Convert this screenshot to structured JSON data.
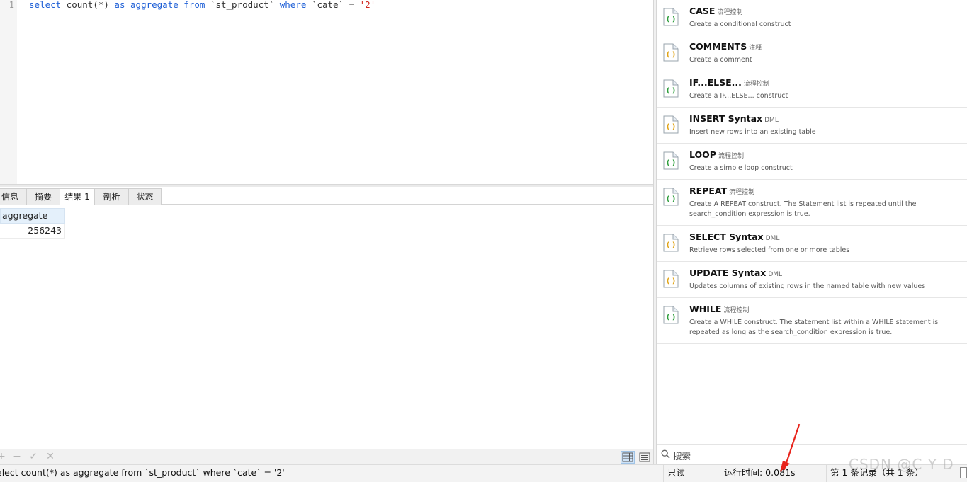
{
  "editor": {
    "line_number": "1",
    "tokens": {
      "t1": "select",
      "t2": " count(*) ",
      "t3": "as",
      "t4": " ",
      "t5": "aggregate",
      "t6": " ",
      "t7": "from",
      "t8": " `st_product` ",
      "t9": "where",
      "t10": " `cate` = ",
      "t11": "'2'"
    }
  },
  "tabs": [
    {
      "label": "信息"
    },
    {
      "label": "摘要"
    },
    {
      "label": "结果 1"
    },
    {
      "label": "剖析"
    },
    {
      "label": "状态"
    }
  ],
  "result": {
    "columns": [
      "aggregate"
    ],
    "rows": [
      [
        "256243"
      ]
    ]
  },
  "toolbar": {
    "add_icon": "+",
    "delete_icon": "−",
    "apply_icon": "✓",
    "discard_icon": "✕"
  },
  "status": {
    "sql": "elect count(*) as aggregate from `st_product` where `cate` = '2'",
    "readonly": "只读",
    "runtime": "运行时间: 0.081s",
    "records": "第 1 条记录（共 1 条）"
  },
  "snippets": [
    {
      "title": "CASE",
      "tag": "流程控制",
      "desc": "Create a conditional construct",
      "icon": "code-snippet-icon",
      "icon_color": "#2e9e3c"
    },
    {
      "title": "COMMENTS",
      "tag": "注释",
      "desc": "Create a comment",
      "icon": "code-snippet-icon",
      "icon_color": "#e0a417"
    },
    {
      "title": "IF...ELSE...",
      "tag": "流程控制",
      "desc": "Create a IF...ELSE... construct",
      "icon": "code-snippet-icon",
      "icon_color": "#2e9e3c"
    },
    {
      "title": "INSERT Syntax",
      "tag": "DML",
      "desc": "Insert new rows into an existing table",
      "icon": "code-snippet-icon",
      "icon_color": "#e0a417"
    },
    {
      "title": "LOOP",
      "tag": "流程控制",
      "desc": "Create a simple loop construct",
      "icon": "code-snippet-icon",
      "icon_color": "#2e9e3c"
    },
    {
      "title": "REPEAT",
      "tag": "流程控制",
      "desc": "Create A REPEAT construct. The Statement list is repeated until the search_condition expression is true.",
      "icon": "code-snippet-icon",
      "icon_color": "#2e9e3c"
    },
    {
      "title": "SELECT Syntax",
      "tag": "DML",
      "desc": "Retrieve rows selected from one or more tables",
      "icon": "code-snippet-icon",
      "icon_color": "#e0a417"
    },
    {
      "title": "UPDATE Syntax",
      "tag": "DML",
      "desc": "Updates columns of existing rows in the named table with new values",
      "icon": "code-snippet-icon",
      "icon_color": "#e0a417"
    },
    {
      "title": "WHILE",
      "tag": "流程控制",
      "desc": "Create a WHILE construct. The statement list within a WHILE statement is repeated as long as the search_condition expression is true.",
      "icon": "code-snippet-icon",
      "icon_color": "#2e9e3c"
    }
  ],
  "snippet_search": {
    "label": "搜索",
    "icon": "search-icon"
  },
  "watermark": "CSDN @C Y D",
  "colors": {
    "keyword": "#1e5fd6",
    "string": "#d0241a",
    "annotation_arrow": "#e8231b",
    "header_bg": "#e4f0fb"
  }
}
